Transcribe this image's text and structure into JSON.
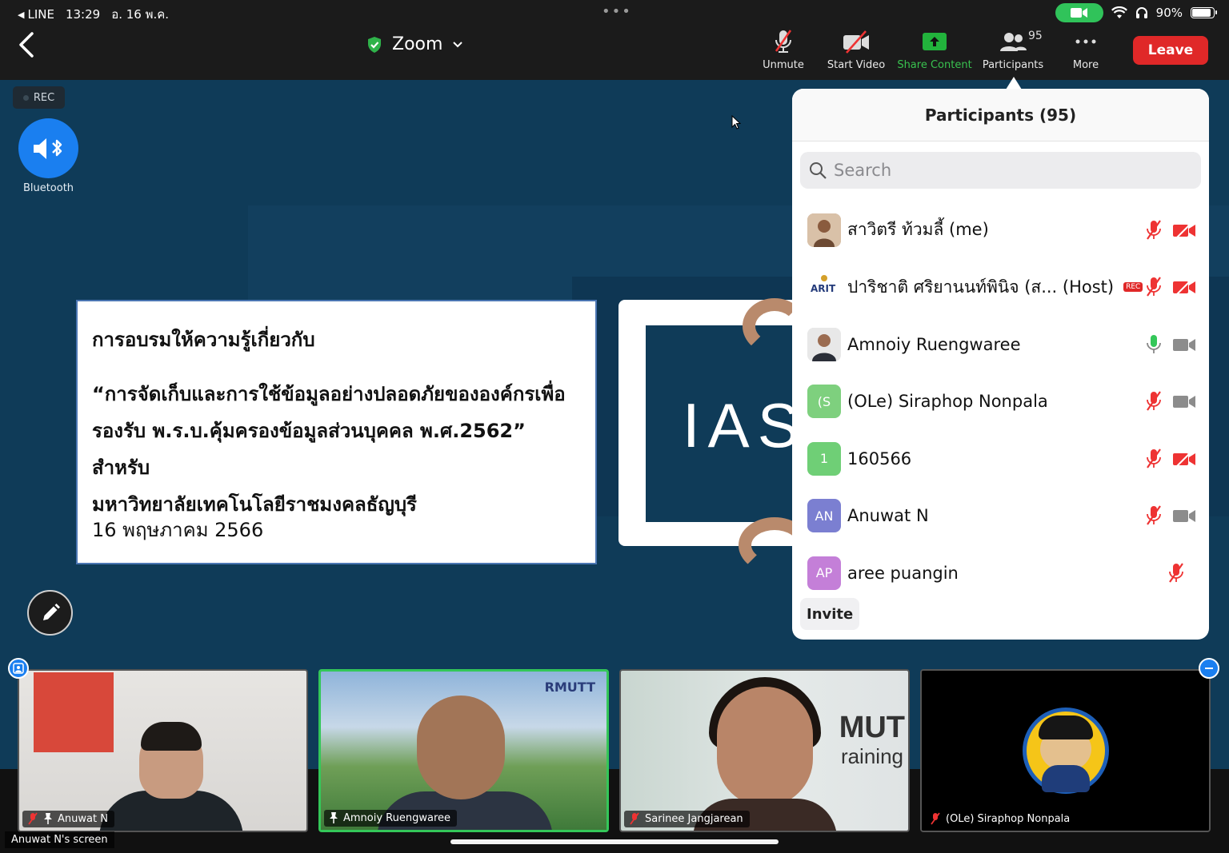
{
  "status_bar": {
    "back_app": "LINE",
    "time": "13:29",
    "date": "อ. 16 พ.ค.",
    "battery": "90%",
    "battery_level": 0.9
  },
  "toolbar": {
    "meeting_title": "Zoom",
    "unmute_label": "Unmute",
    "start_video_label": "Start Video",
    "share_label": "Share Content",
    "participants_label": "Participants",
    "participants_count": "95",
    "more_label": "More",
    "leave_label": "Leave"
  },
  "stage": {
    "rec_label": "REC",
    "bluetooth_label": "Bluetooth",
    "slide": {
      "line1": "การอบรมให้ความรู้เกี่ยวกับ",
      "line2": "“การจัดเก็บและการใช้ข้อมูลอย่างปลอดภัยขององค์กรเพื่อ",
      "line3": "รองรับ พ.ร.บ.คุ้มครองข้อมูลส่วนบุคคล พ.ศ.2562” สำหรับ",
      "line4": "มหาวิทยาลัยเทคโนโลยีราชมงคลธัญบุรี",
      "date": "16 พฤษภาคม 2566"
    },
    "logo_text": "IAS"
  },
  "panel": {
    "title": "Participants (95)",
    "search_placeholder": "Search",
    "participants": [
      {
        "name": "สาวิตรี ท้วมลี้ (me)",
        "avatar": "",
        "avatar_color": "#c9a98c",
        "mic": "muted",
        "video": "off"
      },
      {
        "name": "ปาริชาติ ศริยานนท์พินิจ (ส... (Host)",
        "avatar": "",
        "avatar_color": "#ffffff",
        "rec": "REC",
        "mic": "muted",
        "video": "off"
      },
      {
        "name": "Amnoiy Ruengwaree",
        "avatar": "",
        "avatar_color": "#d9d9d9",
        "mic": "on",
        "video": "on"
      },
      {
        "name": "(OLe) Siraphop Nonpala",
        "avatar": "(S",
        "avatar_color": "#7ed07e",
        "mic": "muted",
        "video": "on"
      },
      {
        "name": "160566",
        "avatar": "1",
        "avatar_color": "#6fcf76",
        "mic": "muted",
        "video": "off"
      },
      {
        "name": "Anuwat N",
        "avatar": "AN",
        "avatar_color": "#7b7fd1",
        "mic": "muted",
        "video": "on"
      },
      {
        "name": "aree puangin",
        "avatar": "AP",
        "avatar_color": "#c47fd8",
        "mic": "muted",
        "video": "none"
      }
    ],
    "invite_label": "Invite"
  },
  "videos": [
    {
      "name": "Anuwat N",
      "muted": true,
      "pinned": true,
      "active": false
    },
    {
      "name": "Amnoiy Ruengwaree",
      "muted": false,
      "pinned": true,
      "active": true
    },
    {
      "name": "Sarinee Jangjarean",
      "muted": true,
      "pinned": false,
      "active": false
    },
    {
      "name": "(OLe) Siraphop Nonpala",
      "muted": true,
      "pinned": false,
      "active": false
    }
  ],
  "tile_brand": "RMUTT",
  "tile_words": {
    "line1": "MUT",
    "line2": "raining"
  },
  "screen_label": "Anuwat N's screen"
}
